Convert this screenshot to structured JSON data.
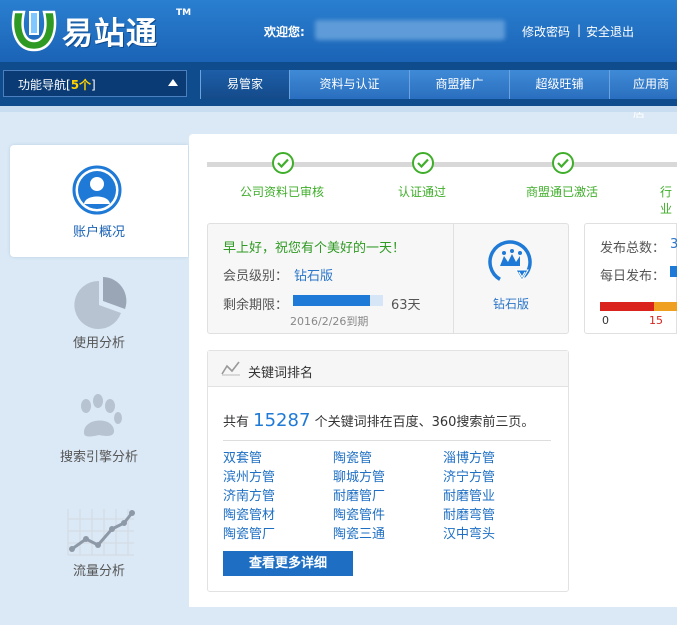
{
  "header": {
    "logo_text": "易站通",
    "logo_tm": "TM",
    "welcome": "欢迎您:",
    "change_password": "修改密码",
    "separator": "|",
    "logout": "安全退出"
  },
  "nav": {
    "func_nav_label": "功能导航[",
    "func_nav_count": "5个",
    "func_nav_suffix": "]",
    "tabs": [
      {
        "label": "易管家",
        "active": true
      },
      {
        "label": "资料与认证",
        "active": false
      },
      {
        "label": "商盟推广",
        "active": false
      },
      {
        "label": "超级旺铺",
        "active": false
      },
      {
        "label": "应用商店",
        "active": false
      }
    ]
  },
  "sidebar": {
    "items": [
      {
        "label": "账户概况",
        "icon": "user-icon",
        "active": true
      },
      {
        "label": "使用分析",
        "icon": "pie-chart-icon",
        "active": false
      },
      {
        "label": "搜索引擎分析",
        "icon": "paw-icon",
        "active": false
      },
      {
        "label": "流量分析",
        "icon": "line-chart-icon",
        "active": false
      }
    ]
  },
  "steps": [
    {
      "label": "公司资料已审核"
    },
    {
      "label": "认证通过"
    },
    {
      "label": "商盟通已激活"
    },
    {
      "label": "行业"
    }
  ],
  "account": {
    "greeting": "早上好，祝您有个美好的一天！",
    "level_label": "会员级别：",
    "level_value": "钻石版",
    "remain_label": "剩余期限：",
    "remain_days": "63天",
    "remain_fraction": 0.85,
    "expiry": "2016/2/26到期",
    "badge_label": "钻石版"
  },
  "stats": {
    "publish_total_label": "发布总数：",
    "publish_total_value": "3",
    "publish_daily_label": "每日发布：",
    "gauge_min": "0",
    "gauge_mark": "15"
  },
  "keywords": {
    "title": "关键词排名",
    "summary_prefix": "共有",
    "count": "15287",
    "summary_suffix": "个关键词排在百度、360搜索前三页。",
    "columns": [
      [
        "双套管",
        "滨州方管",
        "济南方管",
        "陶瓷管材",
        "陶瓷管厂"
      ],
      [
        "陶瓷管",
        "聊城方管",
        "耐磨管厂",
        "陶瓷管件",
        "陶瓷三通"
      ],
      [
        "淄博方管",
        "济宁方管",
        "耐磨管业",
        "耐磨弯管",
        "汉中弯头"
      ]
    ],
    "more_button": "查看更多详细"
  },
  "colors": {
    "header_blue": "#1b63b6",
    "nav_dark": "#0f4c8e",
    "success_green": "#3fae2a",
    "link_blue": "#1e6fc4",
    "gauge_red": "#d9231c"
  }
}
